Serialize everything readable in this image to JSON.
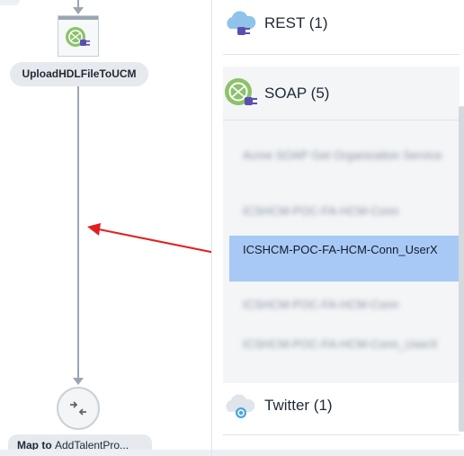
{
  "canvas": {
    "node_label": "UploadHDLFileToUCM",
    "map_prefix": "Map to ",
    "map_target": "AddTalentPro..."
  },
  "panel": {
    "categories": {
      "rest": "REST (1)",
      "soap": "SOAP (5)",
      "twitter": "Twitter (1)"
    },
    "soap_connections": [
      "Acme SOAP Get Organization Service",
      "ICSHCM-POC-FA-HCM-Conn",
      "ICSHCM-POC-FA-HCM-Conn_UserX",
      "ICSHCM-POC-FA-HCM-Conn",
      "ICSHCM-POC-FA-HCM-Conn_UserX"
    ],
    "selected_index": 2
  },
  "colors": {
    "selection": "#a8c9f5",
    "annotation_arrow": "#e02020",
    "flow_line": "#9aa6b2"
  }
}
